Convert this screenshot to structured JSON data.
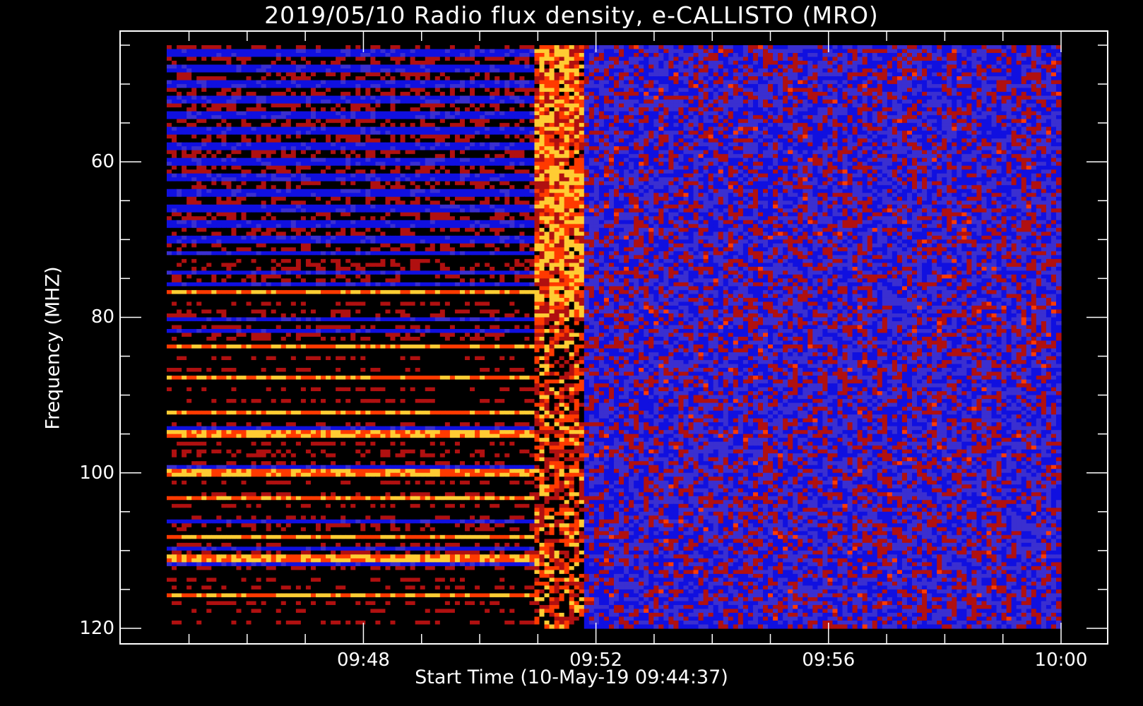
{
  "chart_data": {
    "type": "heatmap",
    "title": "2019/05/10  Radio flux density, e-CALLISTO (MRO)",
    "xlabel": "Start Time (10-May-19 09:44:37)",
    "ylabel": "Frequency (MHZ)",
    "x_start": "09:44:37",
    "x_end": "10:00:00",
    "xlim": [
      "09:44:37",
      "10:00:00"
    ],
    "ylim": [
      45,
      120
    ],
    "y_inverted": true,
    "x_ticks": [
      {
        "time": "09:48",
        "label": "09:48"
      },
      {
        "time": "09:52",
        "label": "09:52"
      },
      {
        "time": "09:56",
        "label": "09:56"
      },
      {
        "time": "10:00",
        "label": "10:00"
      }
    ],
    "y_ticks": [
      {
        "value": 60,
        "label": "60"
      },
      {
        "value": 80,
        "label": "80"
      },
      {
        "value": 100,
        "label": "100"
      },
      {
        "value": 120,
        "label": "120"
      }
    ],
    "x_minor_ticks": [
      "09:45",
      "09:46",
      "09:47",
      "09:48",
      "09:49",
      "09:50",
      "09:51",
      "09:52",
      "09:53",
      "09:54",
      "09:55",
      "09:56",
      "09:57",
      "09:58",
      "09:59",
      "10:00"
    ],
    "y_minor_ticks": [
      45,
      50,
      55,
      60,
      65,
      70,
      75,
      80,
      85,
      90,
      95,
      100,
      105,
      110,
      115,
      120
    ],
    "colormap": [
      "#000000",
      "#1010e0",
      "#3a2fd0",
      "#b01010",
      "#ff3a00",
      "#ffcc33",
      "#ffffff"
    ],
    "features": {
      "burst_start": "09:50:55",
      "burst_end": "09:51:50",
      "interference_end": "09:51:25",
      "interference_bands_mhz": [
        45,
        47,
        49,
        51,
        53,
        55,
        57,
        59,
        61,
        63,
        65,
        67,
        69,
        71,
        72.6,
        73.5,
        75,
        76.8,
        78.2,
        79.5,
        81.1,
        82.5,
        83.8,
        85.2,
        86.6,
        87.8,
        89.3,
        90.7,
        92.3,
        93.6,
        95.0,
        96.3,
        97.5,
        98.6,
        100.0,
        101.3,
        102.6,
        103.3,
        104.2,
        105.6,
        107.0,
        108.2,
        109.1,
        110.5,
        111.0,
        112.4,
        113.6,
        114.8,
        115.8,
        116.8,
        117.9,
        119.2
      ],
      "bright_bands_mhz": [
        76.7,
        83.8,
        87.8,
        92.3,
        95.0,
        100.0,
        103.3,
        108.2,
        111.0,
        115.8
      ]
    }
  }
}
